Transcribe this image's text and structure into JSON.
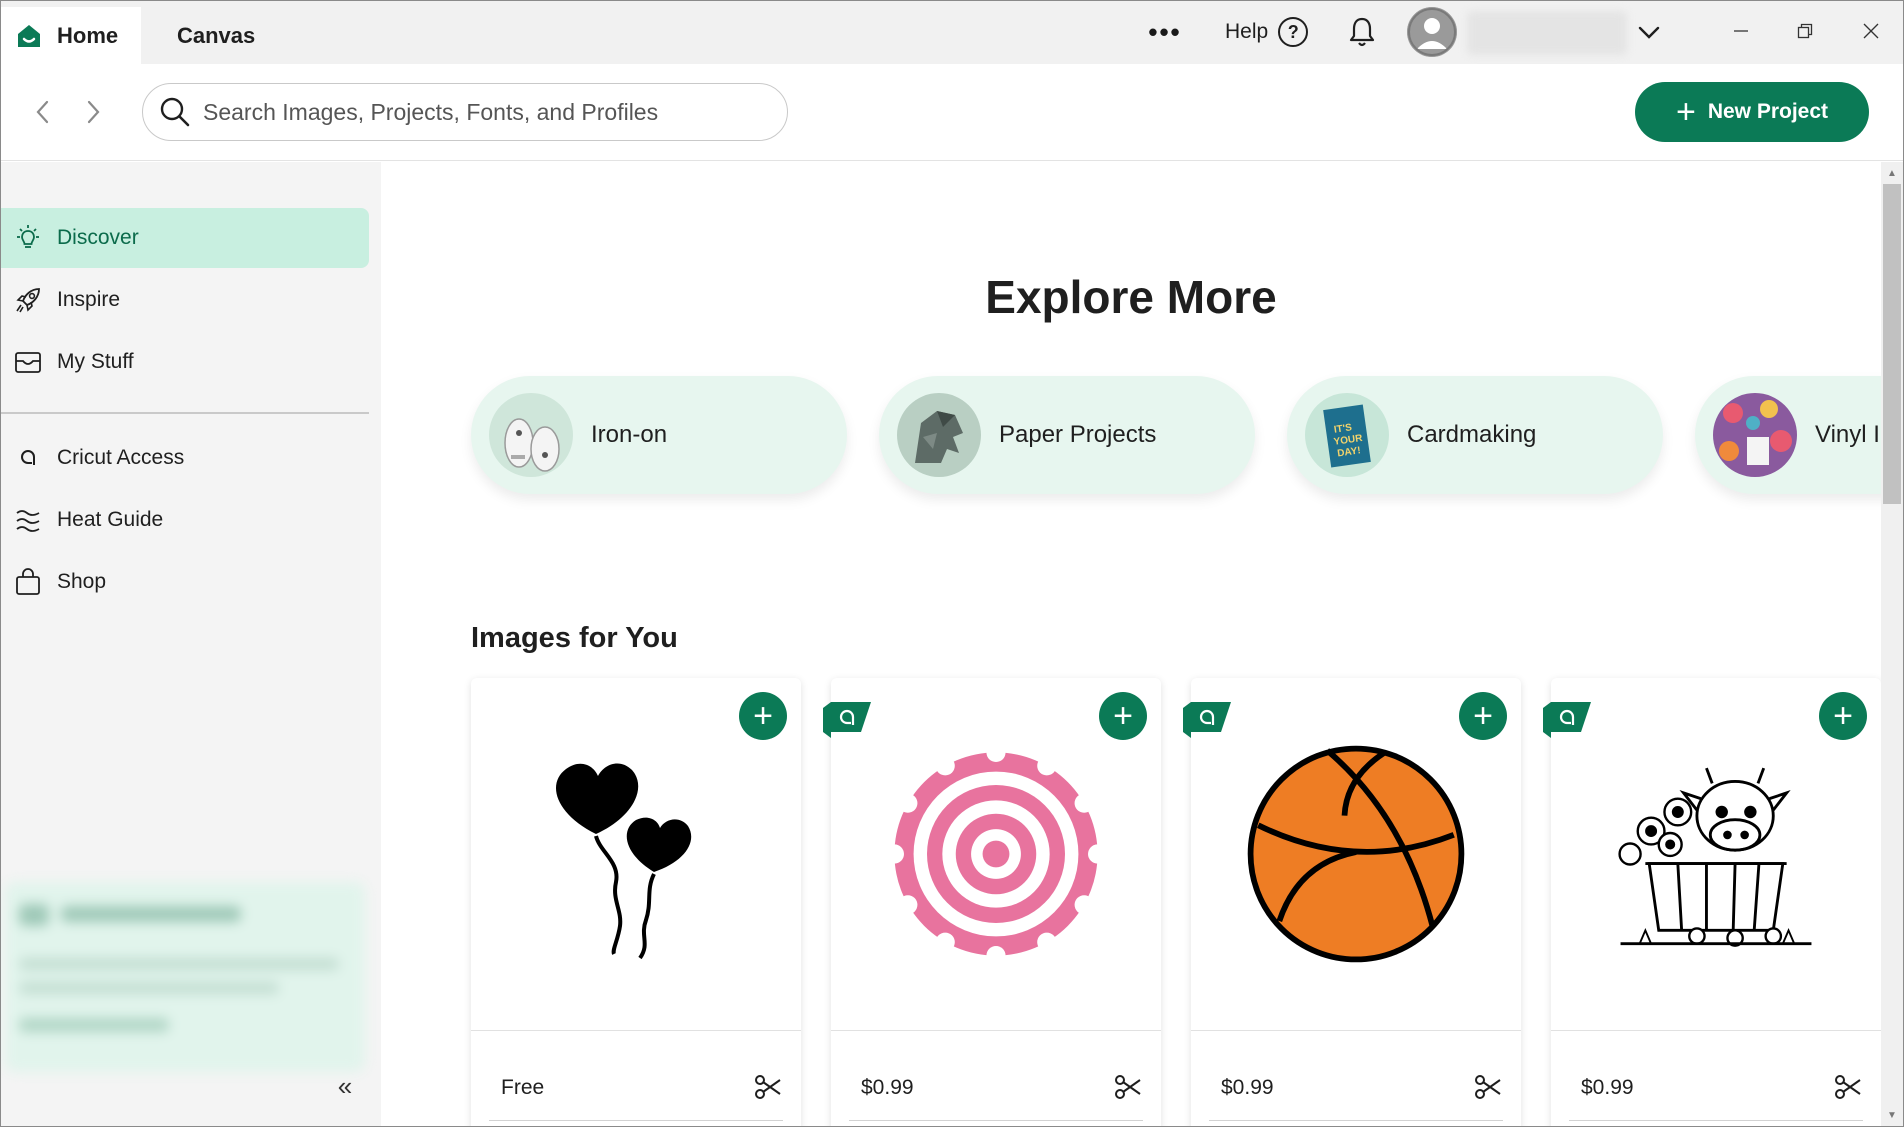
{
  "titlebar": {
    "tabs": [
      "Home",
      "Canvas"
    ],
    "more_icon": "ellipsis-icon",
    "help_label": "Help",
    "help_icon": "question-icon",
    "notifications_icon": "bell-icon",
    "account_icon": "avatar-icon",
    "account_menu_icon": "chevron-down-icon"
  },
  "toolbar": {
    "search_placeholder": "Search Images, Projects, Fonts, and Profiles",
    "new_project_label": "New Project"
  },
  "sidebar": {
    "items": [
      {
        "label": "Discover",
        "icon": "lightbulb-icon",
        "active": true
      },
      {
        "label": "Inspire",
        "icon": "rocket-icon"
      },
      {
        "label": "My Stuff",
        "icon": "inbox-icon"
      },
      {
        "label": "Cricut Access",
        "icon": "access-icon"
      },
      {
        "label": "Heat Guide",
        "icon": "heat-waves-icon"
      },
      {
        "label": "Shop",
        "icon": "shopping-bag-icon"
      }
    ],
    "collapse_label": "«"
  },
  "main": {
    "explore_title": "Explore More",
    "categories": [
      {
        "label": "Iron-on"
      },
      {
        "label": "Paper Projects"
      },
      {
        "label": "Cardmaking"
      },
      {
        "label": "Vinyl I"
      }
    ],
    "images_title": "Images for You",
    "images": [
      {
        "price": "Free",
        "art": "heart balloons",
        "access": false
      },
      {
        "price": "$0.99",
        "art": "rolled paper flower",
        "access": true
      },
      {
        "price": "$0.99",
        "art": "basketball",
        "access": true
      },
      {
        "price": "$0.99",
        "art": "cow in flower basket",
        "access": true
      }
    ]
  },
  "colors": {
    "brand_green": "#0b7a56",
    "active_nav_bg": "#c8efe0",
    "pill_bg": "#e7f6ef"
  }
}
